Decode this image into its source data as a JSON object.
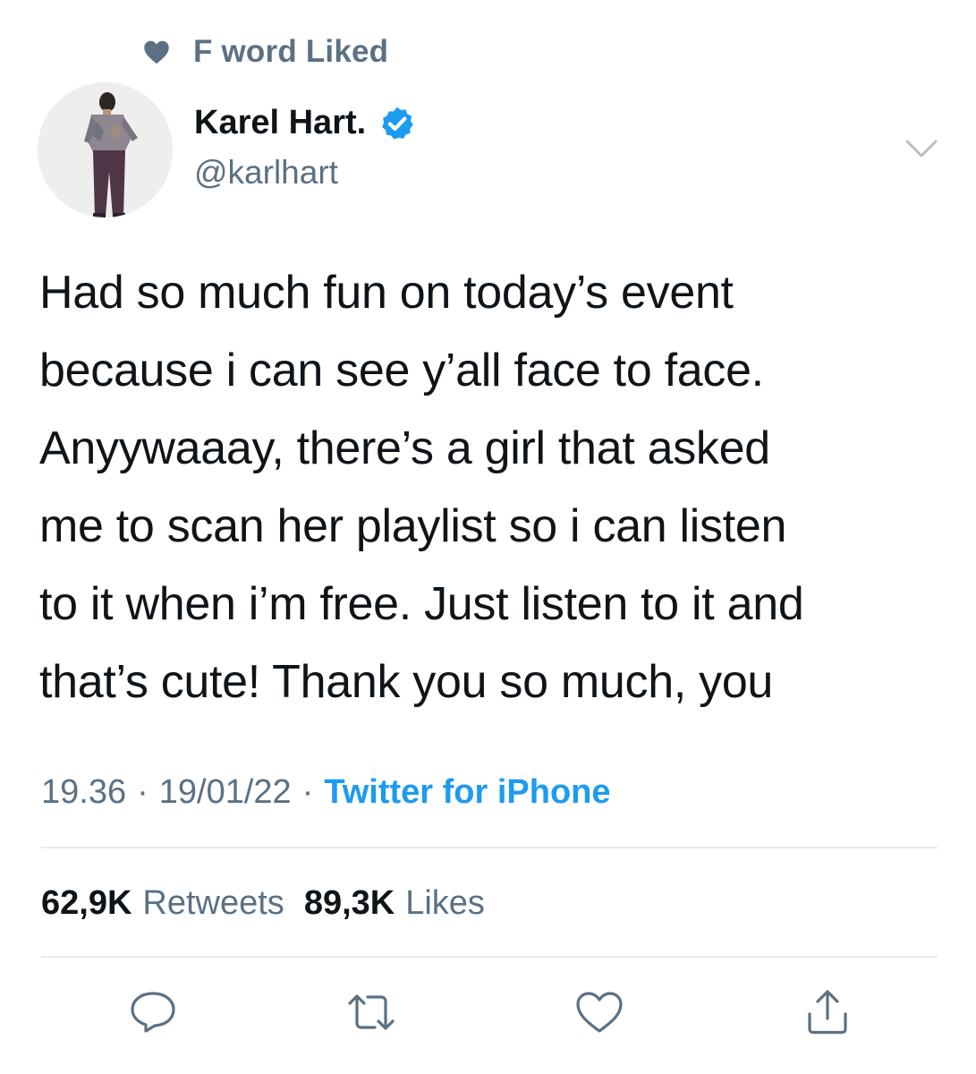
{
  "social_context": {
    "icon": "heart-icon",
    "text": "F word Liked"
  },
  "tweet": {
    "author": {
      "name": "Karel Hart.",
      "handle": "@karlhart",
      "verified": true,
      "avatar_icon": "avatar-photo"
    },
    "text": "Had so much fun on today’s event\nbecause i can see y’all face to face.\nAnyywaaay, there’s a girl that asked\nme to scan her playlist so i can listen\nto it when i’m free. Just listen to it and\nthat’s cute! Thank you so much, you",
    "time": "19.36",
    "separator": "·",
    "date": "19/01/22",
    "source": "Twitter for iPhone",
    "stats": {
      "retweets_count": "62,9K",
      "retweets_label": "Retweets",
      "likes_count": "89,3K",
      "likes_label": "Likes"
    }
  },
  "actions": [
    "reply-icon",
    "retweet-icon",
    "like-icon",
    "share-icon"
  ],
  "colors": {
    "text_primary": "#0f1419",
    "text_secondary": "#5b7083",
    "accent": "#1d9bf0",
    "divider": "#e6ecf0"
  }
}
